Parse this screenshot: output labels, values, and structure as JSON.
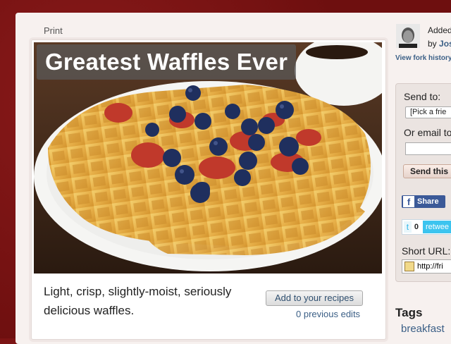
{
  "print_label": "Print",
  "recipe": {
    "title": "Greatest Waffles Ever",
    "description": "Light, crisp, slightly-moist, seriously delicious waffles.",
    "add_button": "Add to your recipes",
    "previous_edits": "0 previous edits"
  },
  "author": {
    "added_prefix": "Added",
    "by_prefix": "by",
    "by_name": "Jos",
    "fork_history": "View fork history"
  },
  "share": {
    "send_to_label": "Send to:",
    "friend_select": "[Pick a frie",
    "email_label": "Or email to",
    "email_value": "",
    "send_button": "Send this r",
    "facebook_label": "Share",
    "tweet_count": "0",
    "tweet_label": "retwee",
    "short_url_label": "Short URL:",
    "short_url_value": "http://fri"
  },
  "tags": {
    "heading": "Tags",
    "items": [
      "breakfast"
    ]
  },
  "colors": {
    "background": "#7d1414",
    "link": "#3b5f86",
    "facebook": "#3b5998",
    "twitter": "#3cc4ef"
  }
}
